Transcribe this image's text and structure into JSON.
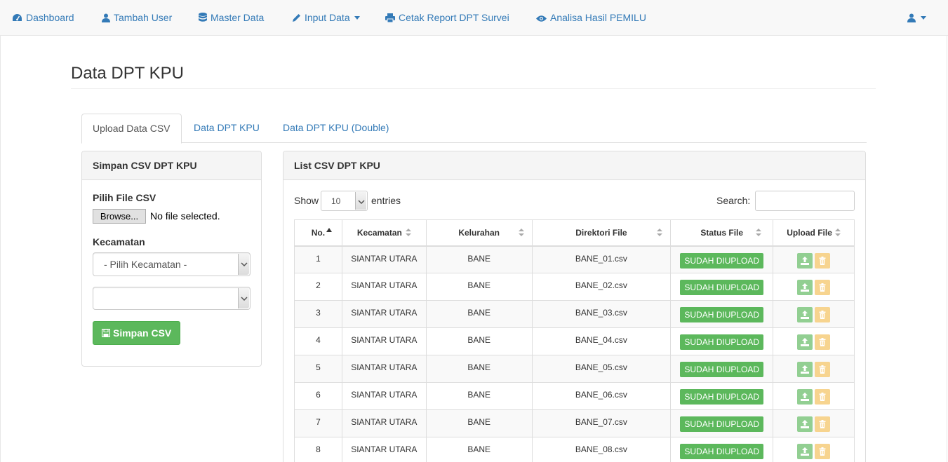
{
  "nav": {
    "dashboard": "Dashboard",
    "tambah_user": "Tambah User",
    "master_data": "Master Data",
    "input_data": "Input Data",
    "cetak_report": "Cetak Report DPT Survei",
    "analisa": "Analisa Hasil PEMILU"
  },
  "page": {
    "title": "Data DPT KPU"
  },
  "tabs": [
    "Upload Data CSV",
    "Data DPT KPU",
    "Data DPT KPU (Double)"
  ],
  "left_panel": {
    "heading": "Simpan CSV DPT KPU",
    "file_label": "Pilih File CSV",
    "browse_label": "Browse...",
    "no_file": "No file selected.",
    "kecamatan_label": "Kecamatan",
    "kecamatan_selected": "- Pilih Kecamatan -",
    "kelurahan_selected": "",
    "save_button": "Simpan CSV"
  },
  "right_panel": {
    "heading": "List CSV DPT KPU",
    "show_label": "Show",
    "page_length": "10",
    "entries_label": "entries",
    "search_label": "Search:",
    "search_value": "",
    "columns": [
      "No.",
      "Kecamatan",
      "Kelurahan",
      "Direktori File",
      "Status File",
      "Upload File"
    ],
    "rows": [
      {
        "no": "1",
        "kecamatan": "SIANTAR UTARA",
        "kelurahan": "BANE",
        "file": "BANE_01.csv",
        "status": "SUDAH DIUPLOAD"
      },
      {
        "no": "2",
        "kecamatan": "SIANTAR UTARA",
        "kelurahan": "BANE",
        "file": "BANE_02.csv",
        "status": "SUDAH DIUPLOAD"
      },
      {
        "no": "3",
        "kecamatan": "SIANTAR UTARA",
        "kelurahan": "BANE",
        "file": "BANE_03.csv",
        "status": "SUDAH DIUPLOAD"
      },
      {
        "no": "4",
        "kecamatan": "SIANTAR UTARA",
        "kelurahan": "BANE",
        "file": "BANE_04.csv",
        "status": "SUDAH DIUPLOAD"
      },
      {
        "no": "5",
        "kecamatan": "SIANTAR UTARA",
        "kelurahan": "BANE",
        "file": "BANE_05.csv",
        "status": "SUDAH DIUPLOAD"
      },
      {
        "no": "6",
        "kecamatan": "SIANTAR UTARA",
        "kelurahan": "BANE",
        "file": "BANE_06.csv",
        "status": "SUDAH DIUPLOAD"
      },
      {
        "no": "7",
        "kecamatan": "SIANTAR UTARA",
        "kelurahan": "BANE",
        "file": "BANE_07.csv",
        "status": "SUDAH DIUPLOAD"
      },
      {
        "no": "8",
        "kecamatan": "SIANTAR UTARA",
        "kelurahan": "BANE",
        "file": "BANE_08.csv",
        "status": "SUDAH DIUPLOAD"
      }
    ]
  },
  "icons": {
    "dashboard": "dashboard-icon",
    "tambah_user": "user-icon",
    "master_data": "database-icon",
    "input_data": "pencil-icon",
    "cetak_report": "print-icon",
    "analisa": "eye-icon",
    "account": "user-icon",
    "save": "floppy-icon",
    "upload": "upload-icon",
    "delete": "trash-icon"
  },
  "colors": {
    "link": "#337ab7",
    "success": "#5cb85c",
    "upload_button": "#92cf92",
    "delete_button": "#f7d48f"
  }
}
